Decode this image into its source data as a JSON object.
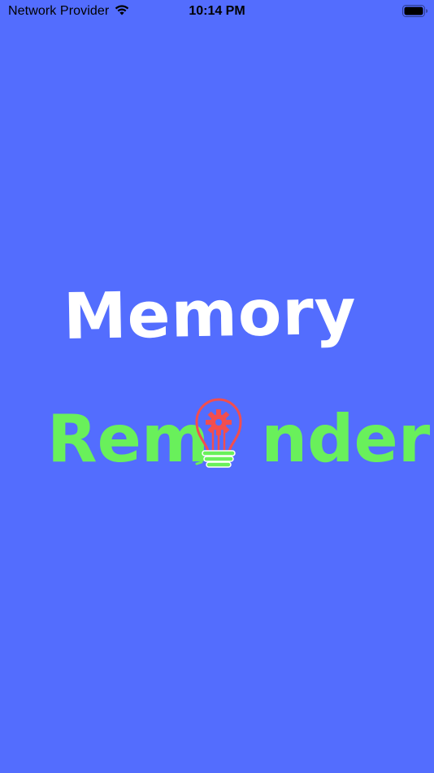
{
  "status_bar": {
    "carrier": "Network Provider",
    "time": "10:14 PM",
    "wifi_icon": "wifi-icon",
    "battery_icon": "battery-icon",
    "battery_level": 1.0
  },
  "splash": {
    "logo": {
      "line_1": "Memory",
      "line_2_prefix": "Rem",
      "line_2_suffix": "nder",
      "bulb_icon": "lightbulb-gear-icon"
    }
  },
  "colors": {
    "background": "#536DFE",
    "line_1_text": "#FFFFFF",
    "line_2_text": "#69F05B",
    "bulb_outline": "#F24E4E",
    "bulb_base": "#69F05B"
  }
}
